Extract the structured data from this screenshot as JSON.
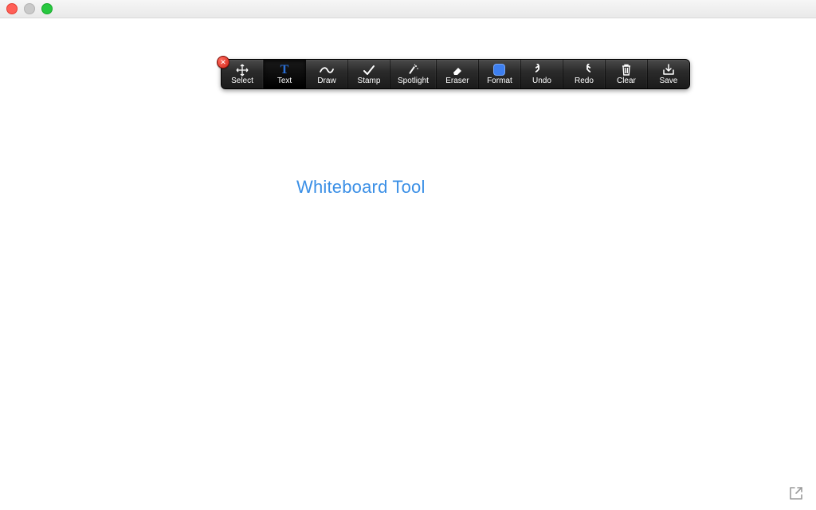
{
  "toolbar": {
    "items": [
      {
        "id": "select",
        "label": "Select"
      },
      {
        "id": "text",
        "label": "Text"
      },
      {
        "id": "draw",
        "label": "Draw"
      },
      {
        "id": "stamp",
        "label": "Stamp"
      },
      {
        "id": "spotlight",
        "label": "Spotlight"
      },
      {
        "id": "eraser",
        "label": "Eraser"
      },
      {
        "id": "format",
        "label": "Format"
      },
      {
        "id": "undo",
        "label": "Undo"
      },
      {
        "id": "redo",
        "label": "Redo"
      },
      {
        "id": "clear",
        "label": "Clear"
      },
      {
        "id": "save",
        "label": "Save"
      }
    ],
    "active_id": "text",
    "close_glyph": "✕"
  },
  "canvas": {
    "text": "Whiteboard Tool",
    "text_color": "#3a8fe6"
  },
  "colors": {
    "active_icon": "#2a6fd6",
    "format_fill": "#3d7ff0"
  }
}
